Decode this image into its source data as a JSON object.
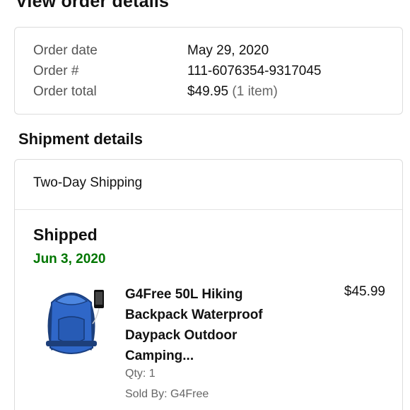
{
  "page": {
    "title": "View order details"
  },
  "order_summary": {
    "date_label": "Order date",
    "date_value": "May 29, 2020",
    "number_label": "Order #",
    "number_value": "111-6076354-9317045",
    "total_label": "Order total",
    "total_value": "$49.95",
    "total_items": "(1 item)"
  },
  "shipment": {
    "section_title": "Shipment details",
    "method": "Two-Day Shipping",
    "status": "Shipped",
    "status_date": "Jun 3, 2020",
    "status_date_color": "#007600",
    "item": {
      "image_icon": "backpack-icon",
      "title": "G4Free 50L Hiking Backpack Waterproof Daypack Outdoor Camping...",
      "price": "$45.99",
      "qty": "Qty: 1",
      "sold_by": "Sold By: G4Free"
    }
  }
}
